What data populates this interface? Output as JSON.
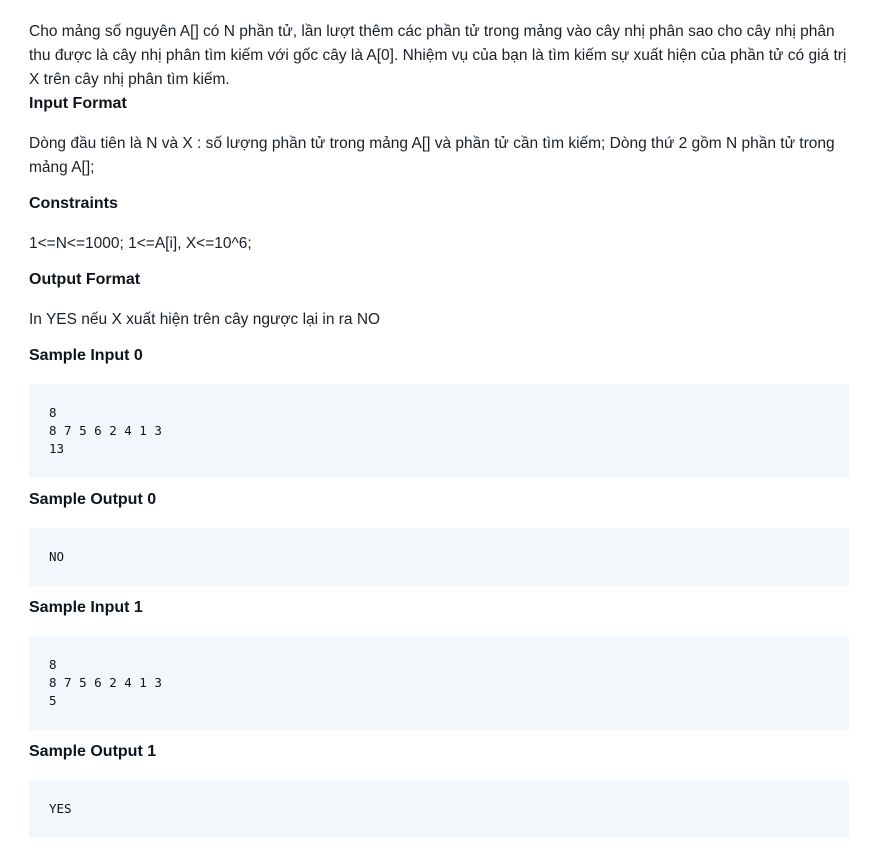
{
  "statement": "Cho mảng số nguyên A[] có N phần tử, lần lượt thêm các phần tử trong mảng vào cây nhị phân sao cho cây nhị phân thu được là cây nhị phân tìm kiếm với gốc cây là A[0]. Nhiệm vụ của bạn là tìm kiếm sự xuất hiện của phần tử có giá trị X trên cây nhị phân tìm kiếm.",
  "input_format": {
    "heading": "Input Format",
    "text": "Dòng đầu tiên là N và X : số lượng phần tử trong mảng A[] và phần tử cần tìm kiếm; Dòng thứ 2 gồm N phần tử trong mảng A[];"
  },
  "constraints": {
    "heading": "Constraints",
    "text": "1<=N<=1000; 1<=A[i], X<=10^6;"
  },
  "output_format": {
    "heading": "Output Format",
    "text": "In YES nếu X xuất hiện trên cây ngược lại in ra NO"
  },
  "samples": [
    {
      "heading": "Sample Input 0",
      "code": "8\n8 7 5 6 2 4 1 3\n13"
    },
    {
      "heading": "Sample Output 0",
      "code": "NO"
    },
    {
      "heading": "Sample Input 1",
      "code": "8\n8 7 5 6 2 4 1 3\n5"
    },
    {
      "heading": "Sample Output 1",
      "code": "YES"
    }
  ]
}
